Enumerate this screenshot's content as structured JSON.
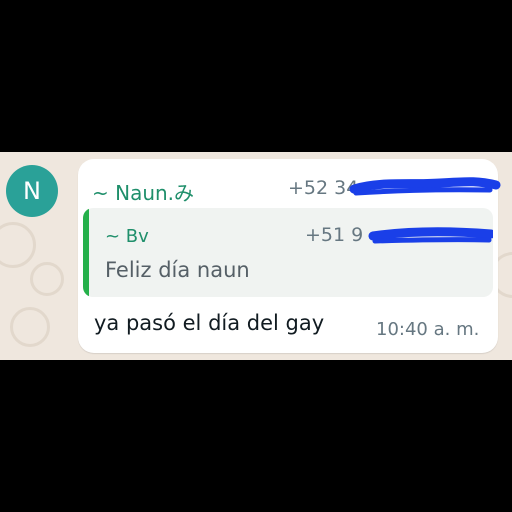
{
  "avatar": {
    "initial": "N",
    "color": "#2aa198"
  },
  "message": {
    "sender_name": "~ Naun.み",
    "sender_phone": "+52 34",
    "quoted": {
      "name": "~ Bv",
      "phone": "+51 9",
      "text": "Feliz día naun",
      "bar_color": "#25b04a"
    },
    "text": "ya pasó el día del gay",
    "timestamp": "10:40 a. m."
  },
  "colors": {
    "redaction": "#1a3fe8",
    "name_green": "#1f8f6b",
    "chat_background": "#efe7de"
  }
}
